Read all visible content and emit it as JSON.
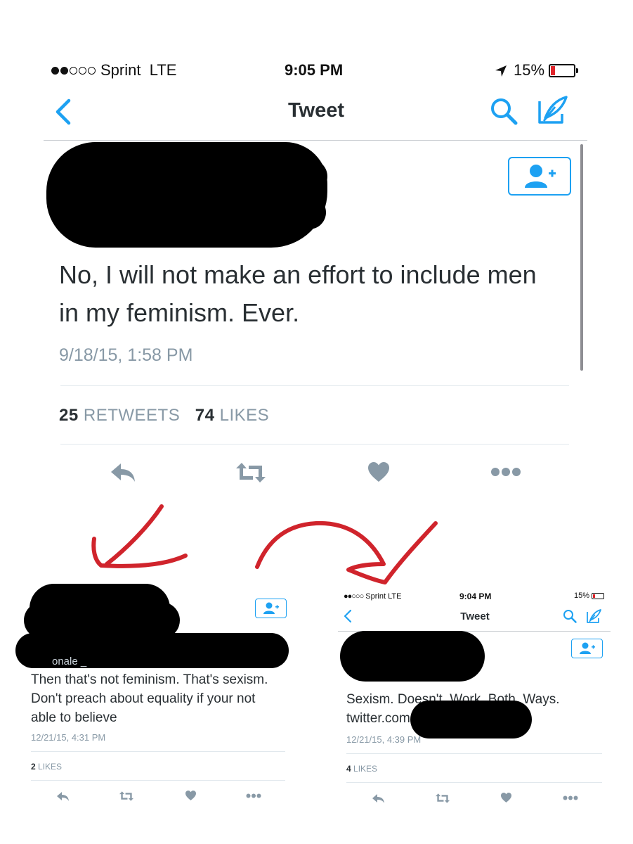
{
  "main": {
    "status": {
      "carrier": "Sprint",
      "network": "LTE",
      "time": "9:05 PM",
      "battery": "15%"
    },
    "nav": {
      "title": "Tweet",
      "back_icon": "chevron-left-icon",
      "search_icon": "search-icon",
      "compose_icon": "compose-icon"
    },
    "tweet": {
      "text_line1": "No, I will not make an effort to include men",
      "text_line2": "in my feminism. Ever.",
      "date": "9/18/15, 1:58 PM",
      "retweets_count": "25",
      "retweets_label": "RETWEETS",
      "likes_count": "74",
      "likes_label": "LIKES"
    }
  },
  "left_reply": {
    "partial_handle": "onale _",
    "text_line1": "Then that's not feminism. That's sexism.",
    "text_line2": "Don't preach about equality if your not",
    "text_line3": "able to believe",
    "date": "12/21/15, 4:31 PM",
    "likes_count": "2",
    "likes_label": "LIKES"
  },
  "right_quote": {
    "status": {
      "carrier": "Sprint",
      "network": "LTE",
      "time": "9:04 PM",
      "battery": "15%"
    },
    "nav": {
      "title": "Tweet"
    },
    "text": "Sexism. Doesn't. Work. Both. Ways.",
    "link": "twitter.com",
    "date": "12/21/15, 4:39 PM",
    "likes_count": "4",
    "likes_label": "LIKES"
  },
  "colors": {
    "accent": "#1da1f2",
    "annotation": "#d0242c",
    "redaction": "#000000",
    "muted": "#8899a6"
  }
}
